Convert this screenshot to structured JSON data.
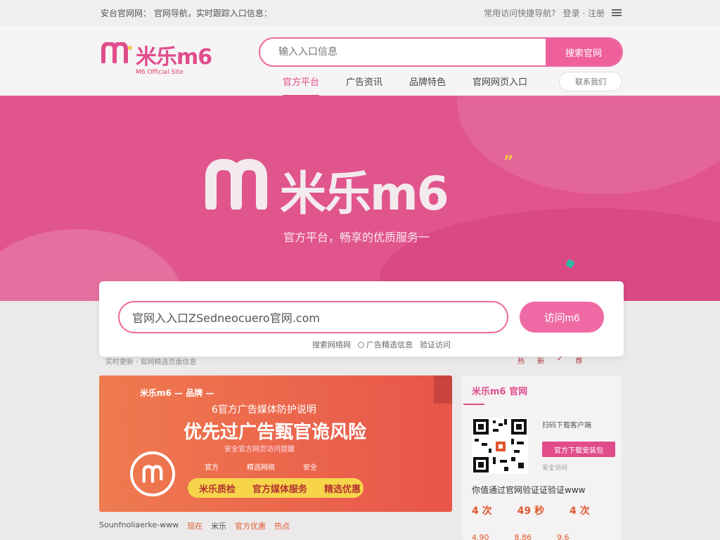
{
  "topbar": {
    "notice": "安台官网网： 官网导航，实时跟踪入口信息：",
    "right_text": "常用访问快捷导航?",
    "right_sub": "登录 · 注册"
  },
  "header": {
    "logo_text": "米乐m6",
    "logo_sub": "M6 Official Site",
    "search_placeholder": "输入入口信息",
    "search_button": "搜索官网",
    "nav": [
      "官方平台",
      "广告资讯",
      "品牌特色",
      "官网网页入口"
    ],
    "nav_pill": "联系我们"
  },
  "hero": {
    "title": "米乐m6",
    "quote_mark": "”",
    "subtitle": "官方平台，畅享的优质服务一"
  },
  "search_card": {
    "input_value": "官网入入口ZSedneocuero官网.com",
    "button": "访问m6",
    "links": [
      "搜索网络网",
      "广告精选信息",
      "验证访问"
    ]
  },
  "strip": {
    "text": "实时更新 · 官网精选页面信息",
    "icons": [
      "热",
      "新",
      "✓",
      "荐"
    ]
  },
  "banner": {
    "top": "米乐m6 — 品牌 —",
    "line1": "6官方广告媒体防护说明",
    "main": "优先过广告甄官诡风险",
    "line2": "安全官方网页访问提醒",
    "cols": [
      "官方",
      "精选网络",
      "安全"
    ],
    "pill_left": "米乐质检",
    "pill_mid": "官方媒体服务",
    "pill_right": "精选优惠"
  },
  "side": {
    "logo": "米乐m6 官网",
    "label": "扫码下载客户端",
    "button": "官方下载安装包",
    "note": "安全访问",
    "desc": "你值通过官网验证证验证www",
    "stats": [
      "4 次",
      "49 秒",
      "4 次"
    ],
    "stats2": [
      "4.90",
      "8.86",
      "9.6"
    ]
  },
  "footer": {
    "items": [
      "Sounfnoliaerke-www",
      "现在",
      "米乐",
      "官方优惠",
      "热点"
    ]
  },
  "colors": {
    "brand_pink": "#e04d8c",
    "hero_bg": "#e1558d",
    "banner_orange": "#ef7b4f",
    "pill_yellow": "#f6d54b"
  }
}
